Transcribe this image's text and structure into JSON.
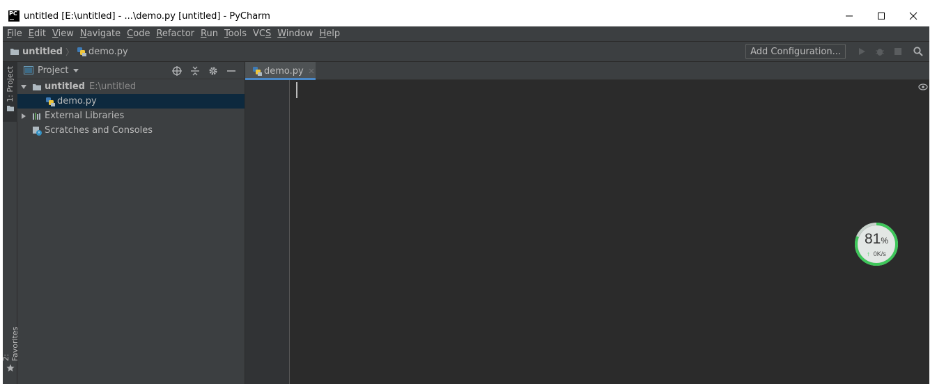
{
  "window": {
    "title": "untitled [E:\\untitled] - ...\\demo.py [untitled] - PyCharm",
    "app_icon_text": "PC"
  },
  "menu": [
    {
      "u": "F",
      "rest": "ile"
    },
    {
      "u": "E",
      "rest": "dit"
    },
    {
      "u": "V",
      "rest": "iew"
    },
    {
      "u": "N",
      "rest": "avigate"
    },
    {
      "u": "C",
      "rest": "ode"
    },
    {
      "u": "R",
      "rest": "efactor"
    },
    {
      "u": "R",
      "rest": "un"
    },
    {
      "u": "T",
      "rest": "ools"
    },
    {
      "pre": "VC",
      "u": "S",
      "rest": ""
    },
    {
      "u": "W",
      "rest": "indow"
    },
    {
      "u": "H",
      "rest": "elp"
    }
  ],
  "breadcrumb": {
    "project": "untitled",
    "file": "demo.py"
  },
  "toolbar": {
    "add_config_label": "Add Configuration..."
  },
  "side_tabs": {
    "project": "1: Project",
    "favorites": "2: Favorites"
  },
  "project_panel": {
    "title": "Project",
    "tree": {
      "root_name": "untitled",
      "root_path": "E:\\untitled",
      "file": "demo.py",
      "external": "External Libraries",
      "scratches": "Scratches and Consoles"
    }
  },
  "editor": {
    "tab_label": "demo.py"
  },
  "speed_widget": {
    "percent": "81",
    "percent_sign": "%",
    "rate": "0K/s",
    "arrow": "↑",
    "ring_color": "#3ec75a",
    "ring_fraction": 0.81
  },
  "colors": {
    "accent": "#4a88c7",
    "selection": "#0d293e",
    "panel": "#3c3f41",
    "editor_bg": "#2b2b2b"
  }
}
